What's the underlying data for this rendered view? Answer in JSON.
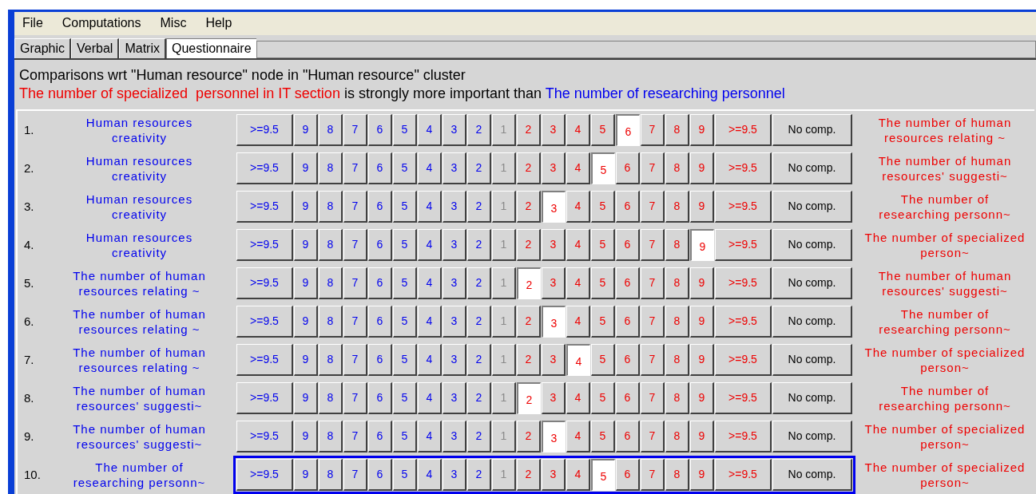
{
  "menu": [
    "File",
    "Computations",
    "Misc",
    "Help"
  ],
  "tabs": [
    {
      "label": "Graphic",
      "selected": false
    },
    {
      "label": "Verbal",
      "selected": false
    },
    {
      "label": "Matrix",
      "selected": false
    },
    {
      "label": "Questionnaire",
      "selected": true
    }
  ],
  "heading": "Comparisons wrt \"Human resource\" node in \"Human resource\" cluster",
  "verdict": {
    "left": "The number of specialized  personnel in IT section",
    "middle": " is strongly more important than ",
    "right": "The number of researching personnel"
  },
  "rows": [
    {
      "number": "1.",
      "left": "Human resources creativity",
      "right": "The number of human resources relating ~",
      "focused": false,
      "buttons": [
        {
          "label": ">=9.5",
          "kind": "left",
          "selected": false
        },
        {
          "label": "9",
          "kind": "left",
          "selected": false
        },
        {
          "label": "8",
          "kind": "left",
          "selected": false
        },
        {
          "label": "7",
          "kind": "left",
          "selected": false
        },
        {
          "label": "6",
          "kind": "left",
          "selected": false
        },
        {
          "label": "5",
          "kind": "left",
          "selected": false
        },
        {
          "label": "4",
          "kind": "left",
          "selected": false
        },
        {
          "label": "3",
          "kind": "left",
          "selected": false
        },
        {
          "label": "2",
          "kind": "left",
          "selected": false
        },
        {
          "label": "1",
          "kind": "equal",
          "selected": false
        },
        {
          "label": "2",
          "kind": "right",
          "selected": false
        },
        {
          "label": "3",
          "kind": "right",
          "selected": false
        },
        {
          "label": "4",
          "kind": "right",
          "selected": false
        },
        {
          "label": "5",
          "kind": "right",
          "selected": false
        },
        {
          "label": "6",
          "kind": "right",
          "selected": true
        },
        {
          "label": "7",
          "kind": "right",
          "selected": false
        },
        {
          "label": "8",
          "kind": "right",
          "selected": false
        },
        {
          "label": "9",
          "kind": "right",
          "selected": false
        },
        {
          "label": ">=9.5",
          "kind": "right",
          "selected": false
        },
        {
          "label": "No comp.",
          "kind": "none",
          "selected": false
        }
      ]
    },
    {
      "number": "2.",
      "left": "Human resources creativity",
      "right": "The number of human resources' suggesti~",
      "focused": false,
      "buttons": [
        {
          "label": ">=9.5",
          "kind": "left",
          "selected": false
        },
        {
          "label": "9",
          "kind": "left",
          "selected": false
        },
        {
          "label": "8",
          "kind": "left",
          "selected": false
        },
        {
          "label": "7",
          "kind": "left",
          "selected": false
        },
        {
          "label": "6",
          "kind": "left",
          "selected": false
        },
        {
          "label": "5",
          "kind": "left",
          "selected": false
        },
        {
          "label": "4",
          "kind": "left",
          "selected": false
        },
        {
          "label": "3",
          "kind": "left",
          "selected": false
        },
        {
          "label": "2",
          "kind": "left",
          "selected": false
        },
        {
          "label": "1",
          "kind": "equal",
          "selected": false
        },
        {
          "label": "2",
          "kind": "right",
          "selected": false
        },
        {
          "label": "3",
          "kind": "right",
          "selected": false
        },
        {
          "label": "4",
          "kind": "right",
          "selected": false
        },
        {
          "label": "5",
          "kind": "right",
          "selected": true
        },
        {
          "label": "6",
          "kind": "right",
          "selected": false
        },
        {
          "label": "7",
          "kind": "right",
          "selected": false
        },
        {
          "label": "8",
          "kind": "right",
          "selected": false
        },
        {
          "label": "9",
          "kind": "right",
          "selected": false
        },
        {
          "label": ">=9.5",
          "kind": "right",
          "selected": false
        },
        {
          "label": "No comp.",
          "kind": "none",
          "selected": false
        }
      ]
    },
    {
      "number": "3.",
      "left": "Human resources creativity",
      "right": "The number of researching personn~",
      "focused": false,
      "buttons": [
        {
          "label": ">=9.5",
          "kind": "left",
          "selected": false
        },
        {
          "label": "9",
          "kind": "left",
          "selected": false
        },
        {
          "label": "8",
          "kind": "left",
          "selected": false
        },
        {
          "label": "7",
          "kind": "left",
          "selected": false
        },
        {
          "label": "6",
          "kind": "left",
          "selected": false
        },
        {
          "label": "5",
          "kind": "left",
          "selected": false
        },
        {
          "label": "4",
          "kind": "left",
          "selected": false
        },
        {
          "label": "3",
          "kind": "left",
          "selected": false
        },
        {
          "label": "2",
          "kind": "left",
          "selected": false
        },
        {
          "label": "1",
          "kind": "equal",
          "selected": false
        },
        {
          "label": "2",
          "kind": "right",
          "selected": false
        },
        {
          "label": "3",
          "kind": "right",
          "selected": true
        },
        {
          "label": "4",
          "kind": "right",
          "selected": false
        },
        {
          "label": "5",
          "kind": "right",
          "selected": false
        },
        {
          "label": "6",
          "kind": "right",
          "selected": false
        },
        {
          "label": "7",
          "kind": "right",
          "selected": false
        },
        {
          "label": "8",
          "kind": "right",
          "selected": false
        },
        {
          "label": "9",
          "kind": "right",
          "selected": false
        },
        {
          "label": ">=9.5",
          "kind": "right",
          "selected": false
        },
        {
          "label": "No comp.",
          "kind": "none",
          "selected": false
        }
      ]
    },
    {
      "number": "4.",
      "left": "Human resources creativity",
      "right": "The number of specialized  person~",
      "focused": false,
      "buttons": [
        {
          "label": ">=9.5",
          "kind": "left",
          "selected": false
        },
        {
          "label": "9",
          "kind": "left",
          "selected": false
        },
        {
          "label": "8",
          "kind": "left",
          "selected": false
        },
        {
          "label": "7",
          "kind": "left",
          "selected": false
        },
        {
          "label": "6",
          "kind": "left",
          "selected": false
        },
        {
          "label": "5",
          "kind": "left",
          "selected": false
        },
        {
          "label": "4",
          "kind": "left",
          "selected": false
        },
        {
          "label": "3",
          "kind": "left",
          "selected": false
        },
        {
          "label": "2",
          "kind": "left",
          "selected": false
        },
        {
          "label": "1",
          "kind": "equal",
          "selected": false
        },
        {
          "label": "2",
          "kind": "right",
          "selected": false
        },
        {
          "label": "3",
          "kind": "right",
          "selected": false
        },
        {
          "label": "4",
          "kind": "right",
          "selected": false
        },
        {
          "label": "5",
          "kind": "right",
          "selected": false
        },
        {
          "label": "6",
          "kind": "right",
          "selected": false
        },
        {
          "label": "7",
          "kind": "right",
          "selected": false
        },
        {
          "label": "8",
          "kind": "right",
          "selected": false
        },
        {
          "label": "9",
          "kind": "right",
          "selected": true
        },
        {
          "label": ">=9.5",
          "kind": "right",
          "selected": false
        },
        {
          "label": "No comp.",
          "kind": "none",
          "selected": false
        }
      ]
    },
    {
      "number": "5.",
      "left": "The number of human resources relating ~",
      "right": "The number of human resources' suggesti~",
      "focused": false,
      "buttons": [
        {
          "label": ">=9.5",
          "kind": "left",
          "selected": false
        },
        {
          "label": "9",
          "kind": "left",
          "selected": false
        },
        {
          "label": "8",
          "kind": "left",
          "selected": false
        },
        {
          "label": "7",
          "kind": "left",
          "selected": false
        },
        {
          "label": "6",
          "kind": "left",
          "selected": false
        },
        {
          "label": "5",
          "kind": "left",
          "selected": false
        },
        {
          "label": "4",
          "kind": "left",
          "selected": false
        },
        {
          "label": "3",
          "kind": "left",
          "selected": false
        },
        {
          "label": "2",
          "kind": "left",
          "selected": false
        },
        {
          "label": "1",
          "kind": "equal",
          "selected": false
        },
        {
          "label": "2",
          "kind": "right",
          "selected": true
        },
        {
          "label": "3",
          "kind": "right",
          "selected": false
        },
        {
          "label": "4",
          "kind": "right",
          "selected": false
        },
        {
          "label": "5",
          "kind": "right",
          "selected": false
        },
        {
          "label": "6",
          "kind": "right",
          "selected": false
        },
        {
          "label": "7",
          "kind": "right",
          "selected": false
        },
        {
          "label": "8",
          "kind": "right",
          "selected": false
        },
        {
          "label": "9",
          "kind": "right",
          "selected": false
        },
        {
          "label": ">=9.5",
          "kind": "right",
          "selected": false
        },
        {
          "label": "No comp.",
          "kind": "none",
          "selected": false
        }
      ]
    },
    {
      "number": "6.",
      "left": "The number of human resources relating ~",
      "right": "The number of researching personn~",
      "focused": false,
      "buttons": [
        {
          "label": ">=9.5",
          "kind": "left",
          "selected": false
        },
        {
          "label": "9",
          "kind": "left",
          "selected": false
        },
        {
          "label": "8",
          "kind": "left",
          "selected": false
        },
        {
          "label": "7",
          "kind": "left",
          "selected": false
        },
        {
          "label": "6",
          "kind": "left",
          "selected": false
        },
        {
          "label": "5",
          "kind": "left",
          "selected": false
        },
        {
          "label": "4",
          "kind": "left",
          "selected": false
        },
        {
          "label": "3",
          "kind": "left",
          "selected": false
        },
        {
          "label": "2",
          "kind": "left",
          "selected": false
        },
        {
          "label": "1",
          "kind": "equal",
          "selected": false
        },
        {
          "label": "2",
          "kind": "right",
          "selected": false
        },
        {
          "label": "3",
          "kind": "right",
          "selected": true
        },
        {
          "label": "4",
          "kind": "right",
          "selected": false
        },
        {
          "label": "5",
          "kind": "right",
          "selected": false
        },
        {
          "label": "6",
          "kind": "right",
          "selected": false
        },
        {
          "label": "7",
          "kind": "right",
          "selected": false
        },
        {
          "label": "8",
          "kind": "right",
          "selected": false
        },
        {
          "label": "9",
          "kind": "right",
          "selected": false
        },
        {
          "label": ">=9.5",
          "kind": "right",
          "selected": false
        },
        {
          "label": "No comp.",
          "kind": "none",
          "selected": false
        }
      ]
    },
    {
      "number": "7.",
      "left": "The number of human resources relating ~",
      "right": "The number of specialized  person~",
      "focused": false,
      "buttons": [
        {
          "label": ">=9.5",
          "kind": "left",
          "selected": false
        },
        {
          "label": "9",
          "kind": "left",
          "selected": false
        },
        {
          "label": "8",
          "kind": "left",
          "selected": false
        },
        {
          "label": "7",
          "kind": "left",
          "selected": false
        },
        {
          "label": "6",
          "kind": "left",
          "selected": false
        },
        {
          "label": "5",
          "kind": "left",
          "selected": false
        },
        {
          "label": "4",
          "kind": "left",
          "selected": false
        },
        {
          "label": "3",
          "kind": "left",
          "selected": false
        },
        {
          "label": "2",
          "kind": "left",
          "selected": false
        },
        {
          "label": "1",
          "kind": "equal",
          "selected": false
        },
        {
          "label": "2",
          "kind": "right",
          "selected": false
        },
        {
          "label": "3",
          "kind": "right",
          "selected": false
        },
        {
          "label": "4",
          "kind": "right",
          "selected": true
        },
        {
          "label": "5",
          "kind": "right",
          "selected": false
        },
        {
          "label": "6",
          "kind": "right",
          "selected": false
        },
        {
          "label": "7",
          "kind": "right",
          "selected": false
        },
        {
          "label": "8",
          "kind": "right",
          "selected": false
        },
        {
          "label": "9",
          "kind": "right",
          "selected": false
        },
        {
          "label": ">=9.5",
          "kind": "right",
          "selected": false
        },
        {
          "label": "No comp.",
          "kind": "none",
          "selected": false
        }
      ]
    },
    {
      "number": "8.",
      "left": "The number of human resources' suggesti~",
      "right": "The number of researching personn~",
      "focused": false,
      "buttons": [
        {
          "label": ">=9.5",
          "kind": "left",
          "selected": false
        },
        {
          "label": "9",
          "kind": "left",
          "selected": false
        },
        {
          "label": "8",
          "kind": "left",
          "selected": false
        },
        {
          "label": "7",
          "kind": "left",
          "selected": false
        },
        {
          "label": "6",
          "kind": "left",
          "selected": false
        },
        {
          "label": "5",
          "kind": "left",
          "selected": false
        },
        {
          "label": "4",
          "kind": "left",
          "selected": false
        },
        {
          "label": "3",
          "kind": "left",
          "selected": false
        },
        {
          "label": "2",
          "kind": "left",
          "selected": false
        },
        {
          "label": "1",
          "kind": "equal",
          "selected": false
        },
        {
          "label": "2",
          "kind": "right",
          "selected": true
        },
        {
          "label": "3",
          "kind": "right",
          "selected": false
        },
        {
          "label": "4",
          "kind": "right",
          "selected": false
        },
        {
          "label": "5",
          "kind": "right",
          "selected": false
        },
        {
          "label": "6",
          "kind": "right",
          "selected": false
        },
        {
          "label": "7",
          "kind": "right",
          "selected": false
        },
        {
          "label": "8",
          "kind": "right",
          "selected": false
        },
        {
          "label": "9",
          "kind": "right",
          "selected": false
        },
        {
          "label": ">=9.5",
          "kind": "right",
          "selected": false
        },
        {
          "label": "No comp.",
          "kind": "none",
          "selected": false
        }
      ]
    },
    {
      "number": "9.",
      "left": "The number of human resources' suggesti~",
      "right": "The number of specialized  person~",
      "focused": false,
      "buttons": [
        {
          "label": ">=9.5",
          "kind": "left",
          "selected": false
        },
        {
          "label": "9",
          "kind": "left",
          "selected": false
        },
        {
          "label": "8",
          "kind": "left",
          "selected": false
        },
        {
          "label": "7",
          "kind": "left",
          "selected": false
        },
        {
          "label": "6",
          "kind": "left",
          "selected": false
        },
        {
          "label": "5",
          "kind": "left",
          "selected": false
        },
        {
          "label": "4",
          "kind": "left",
          "selected": false
        },
        {
          "label": "3",
          "kind": "left",
          "selected": false
        },
        {
          "label": "2",
          "kind": "left",
          "selected": false
        },
        {
          "label": "1",
          "kind": "equal",
          "selected": false
        },
        {
          "label": "2",
          "kind": "right",
          "selected": false
        },
        {
          "label": "3",
          "kind": "right",
          "selected": true
        },
        {
          "label": "4",
          "kind": "right",
          "selected": false
        },
        {
          "label": "5",
          "kind": "right",
          "selected": false
        },
        {
          "label": "6",
          "kind": "right",
          "selected": false
        },
        {
          "label": "7",
          "kind": "right",
          "selected": false
        },
        {
          "label": "8",
          "kind": "right",
          "selected": false
        },
        {
          "label": "9",
          "kind": "right",
          "selected": false
        },
        {
          "label": ">=9.5",
          "kind": "right",
          "selected": false
        },
        {
          "label": "No comp.",
          "kind": "none",
          "selected": false
        }
      ]
    },
    {
      "number": "10.",
      "left": "The number of researching personn~",
      "right": "The number of specialized  person~",
      "focused": true,
      "buttons": [
        {
          "label": ">=9.5",
          "kind": "left",
          "selected": false
        },
        {
          "label": "9",
          "kind": "left",
          "selected": false
        },
        {
          "label": "8",
          "kind": "left",
          "selected": false
        },
        {
          "label": "7",
          "kind": "left",
          "selected": false
        },
        {
          "label": "6",
          "kind": "left",
          "selected": false
        },
        {
          "label": "5",
          "kind": "left",
          "selected": false
        },
        {
          "label": "4",
          "kind": "left",
          "selected": false
        },
        {
          "label": "3",
          "kind": "left",
          "selected": false
        },
        {
          "label": "2",
          "kind": "left",
          "selected": false
        },
        {
          "label": "1",
          "kind": "equal",
          "selected": false
        },
        {
          "label": "2",
          "kind": "right",
          "selected": false
        },
        {
          "label": "3",
          "kind": "right",
          "selected": false
        },
        {
          "label": "4",
          "kind": "right",
          "selected": false
        },
        {
          "label": "5",
          "kind": "right",
          "selected": true
        },
        {
          "label": "6",
          "kind": "right",
          "selected": false
        },
        {
          "label": "7",
          "kind": "right",
          "selected": false
        },
        {
          "label": "8",
          "kind": "right",
          "selected": false
        },
        {
          "label": "9",
          "kind": "right",
          "selected": false
        },
        {
          "label": ">=9.5",
          "kind": "right",
          "selected": false
        },
        {
          "label": "No comp.",
          "kind": "none",
          "selected": false
        }
      ]
    }
  ]
}
